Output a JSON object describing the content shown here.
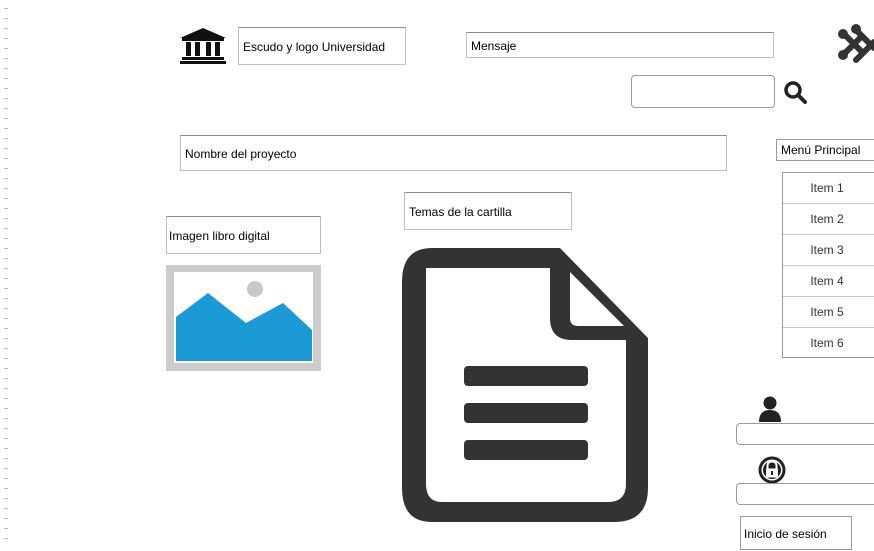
{
  "header": {
    "logo_label": "Escudo y logo Universidad",
    "message_label": "Mensaje"
  },
  "search": {
    "value": ""
  },
  "project": {
    "name_label": "Nombre del proyecto"
  },
  "menu": {
    "title": "Menú Principal",
    "items": [
      {
        "label": "Item 1"
      },
      {
        "label": "Item 2"
      },
      {
        "label": "Item 3"
      },
      {
        "label": "Item 4"
      },
      {
        "label": "Item 5"
      },
      {
        "label": "Item 6"
      }
    ]
  },
  "book": {
    "image_label": "Imagen libro digital"
  },
  "topics": {
    "label": "Temas de la cartilla"
  },
  "login": {
    "username_value": "",
    "password_value": "",
    "button_label": "Inicio de sesión"
  },
  "icons": {
    "institution": "bank-icon",
    "brand": "joomla-icon",
    "search": "search-icon",
    "image": "image-placeholder-icon",
    "document": "document-icon",
    "user": "user-icon",
    "lock": "lock-icon"
  },
  "colors": {
    "image_sky": "#1b9ad6",
    "image_frame": "#cccccc",
    "icon_dark": "#333333"
  }
}
